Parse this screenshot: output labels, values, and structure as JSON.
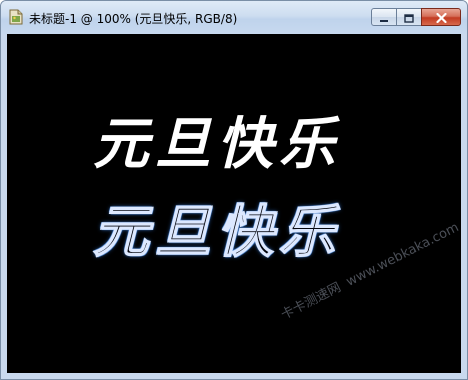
{
  "window": {
    "title": "未标题-1 @ 100% (元旦快乐, RGB/8)",
    "app_icon": "photoshop-document-icon",
    "controls": {
      "minimize": "minimize-icon",
      "maximize": "maximize-icon",
      "close": "close-icon"
    }
  },
  "canvas": {
    "background": "#000000",
    "text_solid": "元旦快乐",
    "text_outline": "元旦快乐",
    "solid_color": "#ffffff",
    "outline_color": "#5a8fd6"
  },
  "watermark": {
    "part1": "卡卡测速网",
    "part2": "www.webkaka.com"
  }
}
